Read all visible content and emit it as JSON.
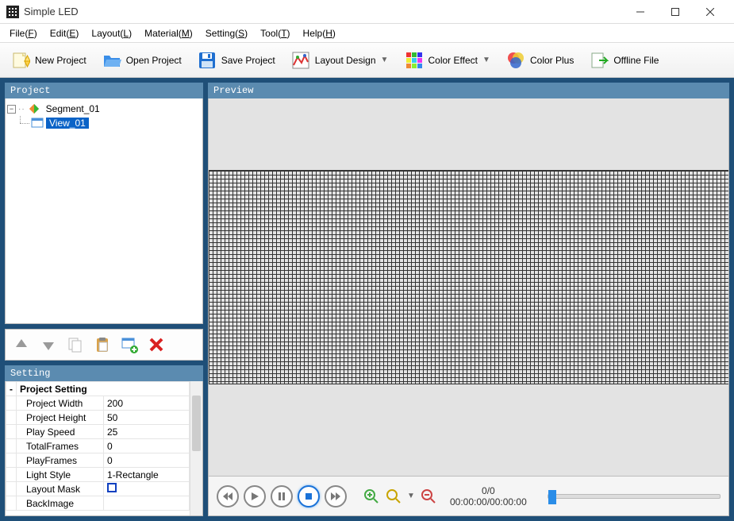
{
  "window": {
    "title": "Simple LED"
  },
  "menus": {
    "file": "File",
    "file_u": "F",
    "edit": "Edit",
    "edit_u": "E",
    "layout": "Layout",
    "layout_u": "L",
    "material": "Material",
    "material_u": "M",
    "setting": "Setting",
    "setting_u": "S",
    "tool": "Tool",
    "tool_u": "T",
    "help": "Help",
    "help_u": "H"
  },
  "toolbar": {
    "new_project": "New Project",
    "open_project": "Open Project",
    "save_project": "Save Project",
    "layout_design": "Layout Design",
    "color_effect": "Color Effect",
    "color_plus": "Color Plus",
    "offline_file": "Offline File"
  },
  "panels": {
    "project": "Project",
    "preview": "Preview",
    "setting": "Setting"
  },
  "tree": {
    "segment": "Segment_01",
    "view": "View_01"
  },
  "settings": {
    "section": "Project Setting",
    "rows": [
      {
        "k": "Project Width",
        "v": "200"
      },
      {
        "k": "Project Height",
        "v": "50"
      },
      {
        "k": "Play Speed",
        "v": "25"
      },
      {
        "k": "TotalFrames",
        "v": "0"
      },
      {
        "k": "PlayFrames",
        "v": "0"
      },
      {
        "k": "Light Style",
        "v": "1-Rectangle"
      },
      {
        "k": "Layout Mask",
        "v": ""
      },
      {
        "k": "BackImage",
        "v": ""
      }
    ]
  },
  "playback": {
    "frame_pos": "0/0",
    "time": "00:00:00/00:00:00"
  }
}
